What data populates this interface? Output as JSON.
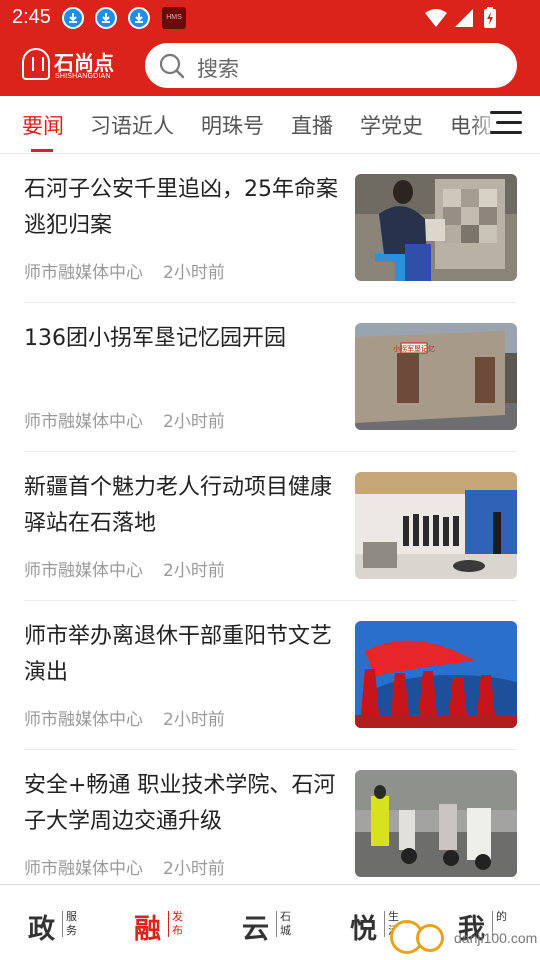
{
  "status_bar": {
    "time": "2:45",
    "hms_label": "HMS",
    "icons": [
      "download-icon",
      "download-icon",
      "download-icon",
      "hms-icon",
      "wifi-icon",
      "signal-icon",
      "battery-icon"
    ]
  },
  "header": {
    "logo_cn": "石尚点",
    "logo_en": "SHISHANGDIAN",
    "search_placeholder": "搜索",
    "brand_color": "#d9231b"
  },
  "tabs": {
    "items": [
      {
        "label": "要闻",
        "active": true
      },
      {
        "label": "习语近人",
        "active": false
      },
      {
        "label": "明珠号",
        "active": false
      },
      {
        "label": "直播",
        "active": false
      },
      {
        "label": "学党史",
        "active": false
      },
      {
        "label": "电视",
        "active": false
      }
    ]
  },
  "news": [
    {
      "title": "石河子公安千里追凶，25年命案逃犯归案",
      "source": "师市融媒体中心",
      "age": "2小时前"
    },
    {
      "title": "136团小拐军垦记忆园开园",
      "source": "师市融媒体中心",
      "age": "2小时前",
      "photo_sign": "小拐军垦记忆"
    },
    {
      "title": "新疆首个魅力老人行动项目健康驿站在石落地",
      "source": "师市融媒体中心",
      "age": "2小时前"
    },
    {
      "title": "师市举办离退休干部重阳节文艺演出",
      "source": "师市融媒体中心",
      "age": "2小时前"
    },
    {
      "title": "安全+畅通 职业技术学院、石河子大学周边交通升级",
      "source": "师市融媒体中心",
      "age": "2小时前"
    }
  ],
  "bottom_nav": [
    {
      "big": "政",
      "small": "服务",
      "active": false
    },
    {
      "big": "融",
      "small": "发布",
      "active": true
    },
    {
      "big": "云",
      "small": "石城",
      "active": false
    },
    {
      "big": "悦",
      "small": "生活",
      "active": false
    },
    {
      "big": "我",
      "small": "的",
      "active": false
    }
  ],
  "watermark": {
    "text": "danji100.com"
  }
}
